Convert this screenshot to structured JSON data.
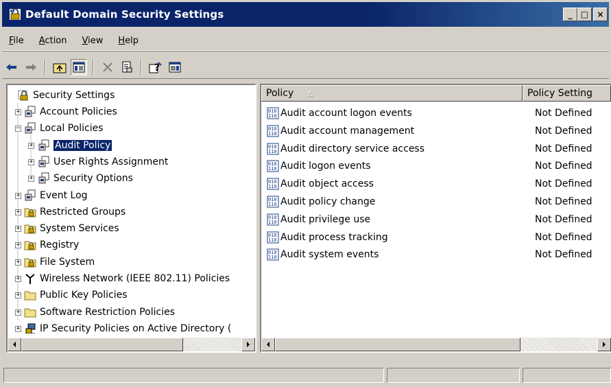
{
  "window": {
    "title": "Default Domain Security Settings",
    "controls": [
      "_",
      "□",
      "×"
    ]
  },
  "menu": {
    "items": [
      "File",
      "Action",
      "View",
      "Help"
    ]
  },
  "toolbar": {
    "icons": [
      "back-arrow-icon",
      "forward-arrow-icon",
      "up-folder-icon",
      "show-tree-icon",
      "delete-icon",
      "properties-icon",
      "help-icon",
      "show-hide-action-pane-icon"
    ]
  },
  "tree": {
    "root": "Security Settings",
    "items": [
      {
        "label": "Account Policies",
        "level": 1,
        "expander": "+"
      },
      {
        "label": "Local Policies",
        "level": 1,
        "expander": "−"
      },
      {
        "label": "Audit Policy",
        "level": 2,
        "expander": "+",
        "selected": true
      },
      {
        "label": "User Rights Assignment",
        "level": 2,
        "expander": "+"
      },
      {
        "label": "Security Options",
        "level": 2,
        "expander": "+"
      },
      {
        "label": "Event Log",
        "level": 1,
        "expander": "+"
      },
      {
        "label": "Restricted Groups",
        "level": 1,
        "expander": "+"
      },
      {
        "label": "System Services",
        "level": 1,
        "expander": "+"
      },
      {
        "label": "Registry",
        "level": 1,
        "expander": "+"
      },
      {
        "label": "File System",
        "level": 1,
        "expander": "+"
      },
      {
        "label": "Wireless Network (IEEE 802.11) Policies",
        "level": 1,
        "expander": "+"
      },
      {
        "label": "Public Key Policies",
        "level": 1,
        "expander": "+"
      },
      {
        "label": "Software Restriction Policies",
        "level": 1,
        "expander": "+"
      },
      {
        "label": "IP Security Policies on Active Directory (",
        "level": 1,
        "expander": "+"
      }
    ]
  },
  "list": {
    "columns": [
      "Policy",
      "Policy Setting"
    ],
    "sort_indicator": "△",
    "rows": [
      {
        "policy": "Audit account logon events",
        "setting": "Not Defined"
      },
      {
        "policy": "Audit account management",
        "setting": "Not Defined"
      },
      {
        "policy": "Audit directory service access",
        "setting": "Not Defined"
      },
      {
        "policy": "Audit logon events",
        "setting": "Not Defined"
      },
      {
        "policy": "Audit object access",
        "setting": "Not Defined"
      },
      {
        "policy": "Audit policy change",
        "setting": "Not Defined"
      },
      {
        "policy": "Audit privilege use",
        "setting": "Not Defined"
      },
      {
        "policy": "Audit process tracking",
        "setting": "Not Defined"
      },
      {
        "policy": "Audit system events",
        "setting": "Not Defined"
      }
    ]
  },
  "colors": {
    "title_bar": "#0a246a",
    "face": "#d4d0c8",
    "selection": "#0a246a"
  }
}
